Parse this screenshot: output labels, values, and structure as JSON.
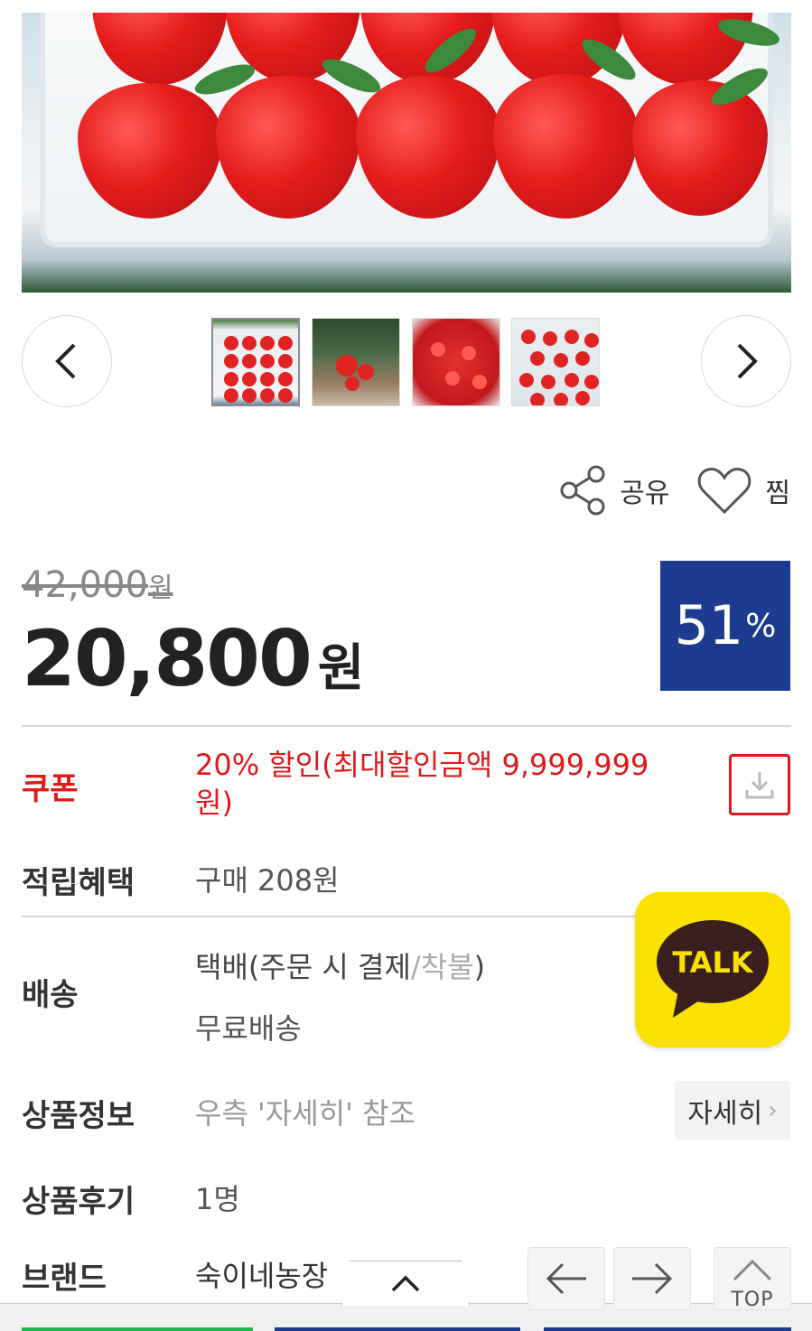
{
  "gallery": {
    "prev_icon": "chevron-left-icon",
    "next_icon": "chevron-right-icon",
    "thumbnails": [
      "thumb-1",
      "thumb-2",
      "thumb-3",
      "thumb-4"
    ],
    "active_index": 0
  },
  "actions": {
    "share_label": "공유",
    "wish_label": "찜"
  },
  "price": {
    "original": "42,000",
    "original_unit": "원",
    "sale": "20,800",
    "sale_unit": "원",
    "discount_value": "51",
    "discount_unit": "%",
    "discount_color": "#1c3d8f"
  },
  "coupon": {
    "label": "쿠폰",
    "value": "20% 할인(최대할인금액 9,999,999원)",
    "accent_color": "#e0191b",
    "download_icon": "download-icon"
  },
  "points": {
    "label": "적립혜택",
    "value": "구매 208원"
  },
  "shipping": {
    "label": "배송",
    "method_prefix": "택배(주문 시 결제",
    "method_sep": "/",
    "method_alt": "착불",
    "method_suffix": ")",
    "fee": "무료배송"
  },
  "product_info": {
    "label": "상품정보",
    "value": "우측 '자세히' 참조",
    "more_label": "자세히"
  },
  "reviews": {
    "label": "상품후기",
    "value": "1명"
  },
  "brand": {
    "label": "브랜드",
    "value": "숙이네농장"
  },
  "kakao": {
    "label": "TALK",
    "color": "#fae100"
  },
  "floating": {
    "top_label": "TOP"
  }
}
